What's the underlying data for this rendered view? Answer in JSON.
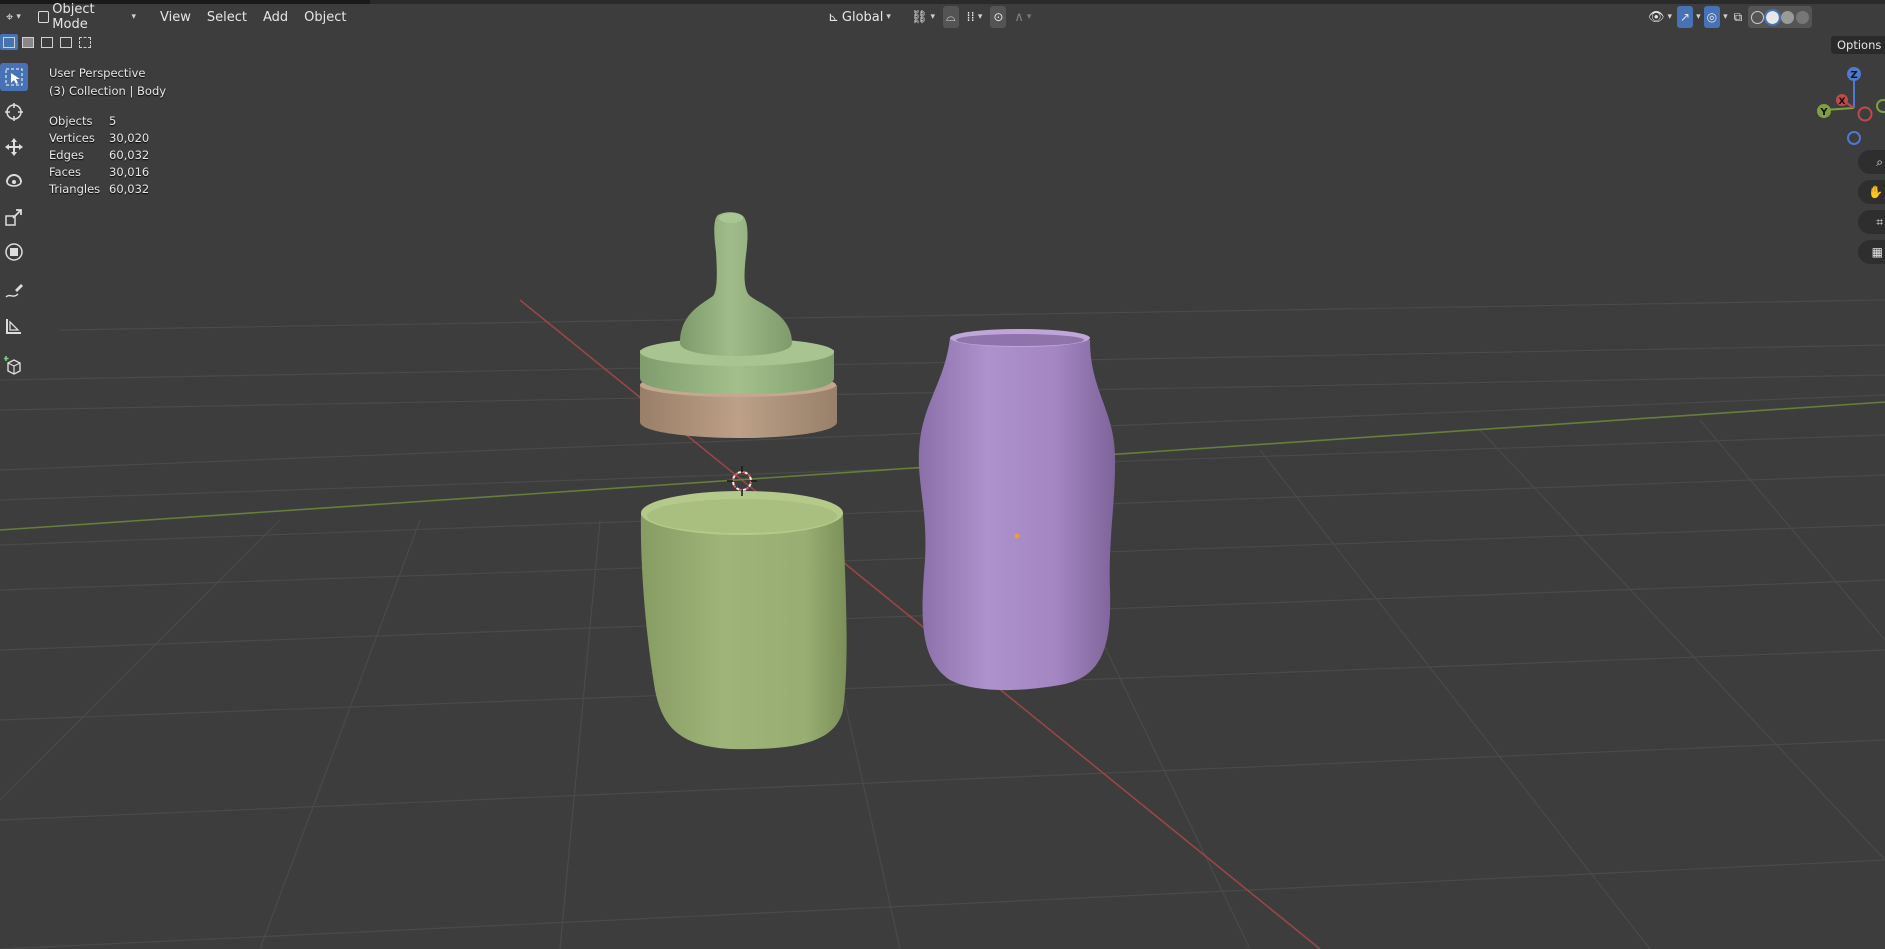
{
  "header": {
    "mode": "Object Mode",
    "menus": [
      "View",
      "Select",
      "Add",
      "Object"
    ],
    "transform_orientation": "Global"
  },
  "overlay": {
    "view_name": "User Perspective",
    "collection": "(3) Collection | Body",
    "stats": [
      {
        "label": "Objects",
        "value": "5"
      },
      {
        "label": "Vertices",
        "value": "30,020"
      },
      {
        "label": "Edges",
        "value": "60,032"
      },
      {
        "label": "Faces",
        "value": "30,016"
      },
      {
        "label": "Triangles",
        "value": "60,032"
      }
    ]
  },
  "options_label": "Options",
  "gizmo": {
    "z": "Z",
    "y": "Y",
    "x": "X"
  },
  "tools": [
    "select-box-icon",
    "cursor-icon",
    "move-icon",
    "rotate-icon",
    "scale-icon",
    "transform-icon",
    "annotate-icon",
    "measure-icon",
    "add-cube-icon"
  ],
  "colors": {
    "viewport_bg": "#3d3d3d",
    "accent": "#4772b3",
    "x_axis": "#c04a4a",
    "y_axis": "#7ea03e",
    "green_bottle": "#9db474",
    "nipple": "#94b07c",
    "ring": "#b0937b",
    "purple_bottle": "#a98bc7"
  }
}
